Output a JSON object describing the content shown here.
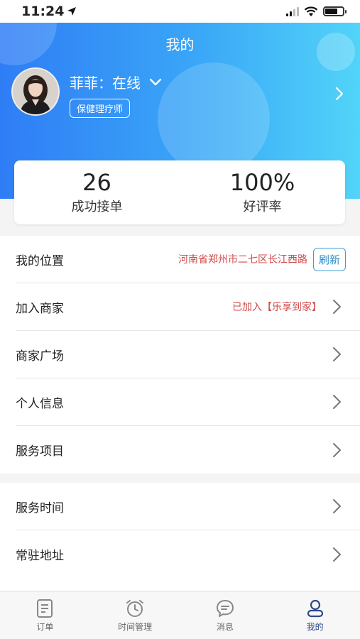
{
  "status_bar": {
    "time": "11:24",
    "battery_level": 0.7
  },
  "header": {
    "title": "我的",
    "username": "菲菲：在线",
    "role": "保健理疗师"
  },
  "stats": [
    {
      "value": "26",
      "label": "成功接单"
    },
    {
      "value": "100%",
      "label": "好评率"
    }
  ],
  "menu": {
    "location": {
      "label": "我的位置",
      "value": "河南省郑州市二七区长江西路",
      "button": "刷新"
    },
    "join_merchant": {
      "label": "加入商家",
      "value": "已加入【乐享到家】"
    },
    "merchant_square": {
      "label": "商家广场"
    },
    "personal_info": {
      "label": "个人信息"
    },
    "service_items": {
      "label": "服务项目"
    },
    "service_time": {
      "label": "服务时间"
    },
    "address": {
      "label": "常驻地址"
    }
  },
  "tabbar": [
    {
      "label": "订单",
      "icon": "orders-icon"
    },
    {
      "label": "时间管理",
      "icon": "clock-icon"
    },
    {
      "label": "消息",
      "icon": "message-icon"
    },
    {
      "label": "我的",
      "icon": "profile-icon",
      "active": true
    }
  ],
  "colors": {
    "accent": "#3aa7f7",
    "value_red": "#d04848",
    "tab_active": "#2d4a8a"
  }
}
